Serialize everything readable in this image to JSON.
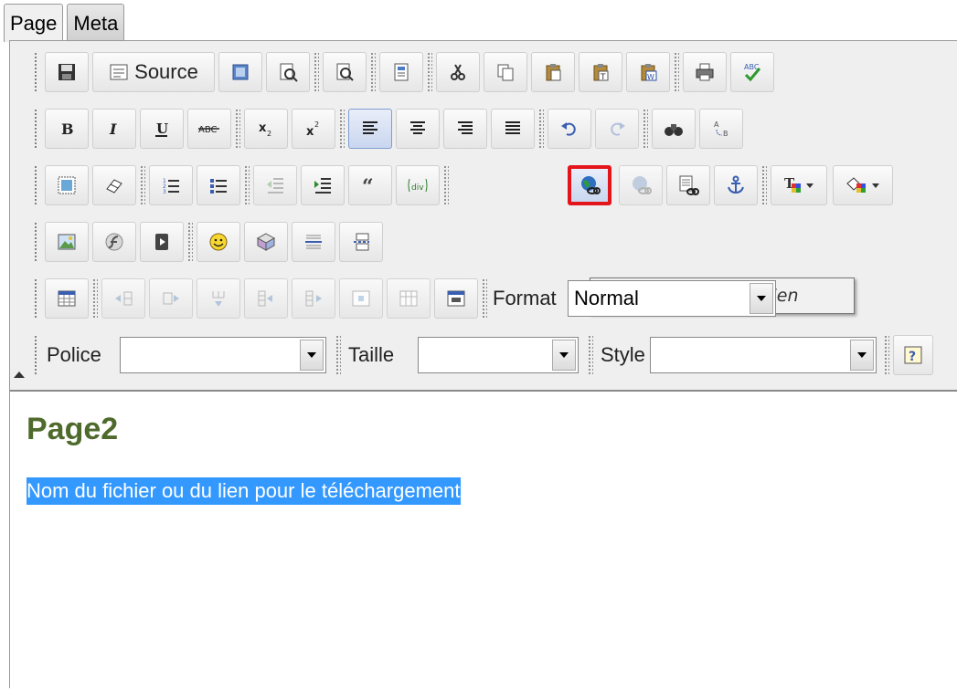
{
  "tabs": [
    {
      "label": "Page"
    },
    {
      "label": "Meta"
    }
  ],
  "toolbar": {
    "source_label": "Source",
    "format": {
      "label": "Format",
      "value": "Normal"
    },
    "police": {
      "label": "Police",
      "value": ""
    },
    "taille": {
      "label": "Taille",
      "value": ""
    },
    "style": {
      "label": "Style",
      "value": ""
    },
    "tooltip": "Insérer/modifier le lien"
  },
  "content": {
    "title": "Page2",
    "selected_text": "Nom du fichier ou du lien pour le téléchargement"
  },
  "colors": {
    "title": "#4e6b2c",
    "selection": "#3399ff",
    "highlight_border": "#e4141b"
  }
}
